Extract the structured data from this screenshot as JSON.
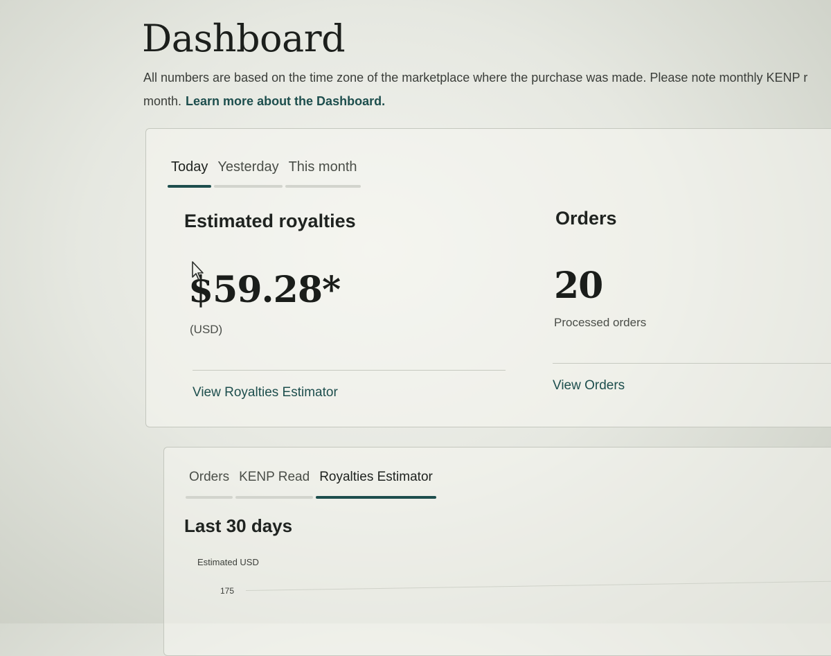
{
  "page": {
    "title": "Dashboard",
    "notice_line1": "All numbers are based on the time zone of the marketplace where the purchase was made. Please note monthly KENP r",
    "notice_line2": "month.",
    "learn_more": "Learn more about the Dashboard."
  },
  "summary_tabs": [
    {
      "label": "Today",
      "active": true
    },
    {
      "label": "Yesterday",
      "active": false
    },
    {
      "label": "This month",
      "active": false
    }
  ],
  "royalties": {
    "label": "Estimated royalties",
    "value": "$59.28*",
    "currency": "(USD)",
    "link": "View Royalties Estimator"
  },
  "orders": {
    "label": "Orders",
    "value": "20",
    "caption": "Processed orders",
    "link": "View Orders"
  },
  "detail_tabs": [
    {
      "label": "Orders",
      "active": false
    },
    {
      "label": "KENP Read",
      "active": false
    },
    {
      "label": "Royalties Estimator",
      "active": true
    }
  ],
  "chart_section": {
    "title": "Last 30 days",
    "axis_title": "Estimated USD",
    "first_tick": "175"
  },
  "colors": {
    "accent": "#1d4e4d",
    "tab_inactive": "#d2d4cd"
  }
}
